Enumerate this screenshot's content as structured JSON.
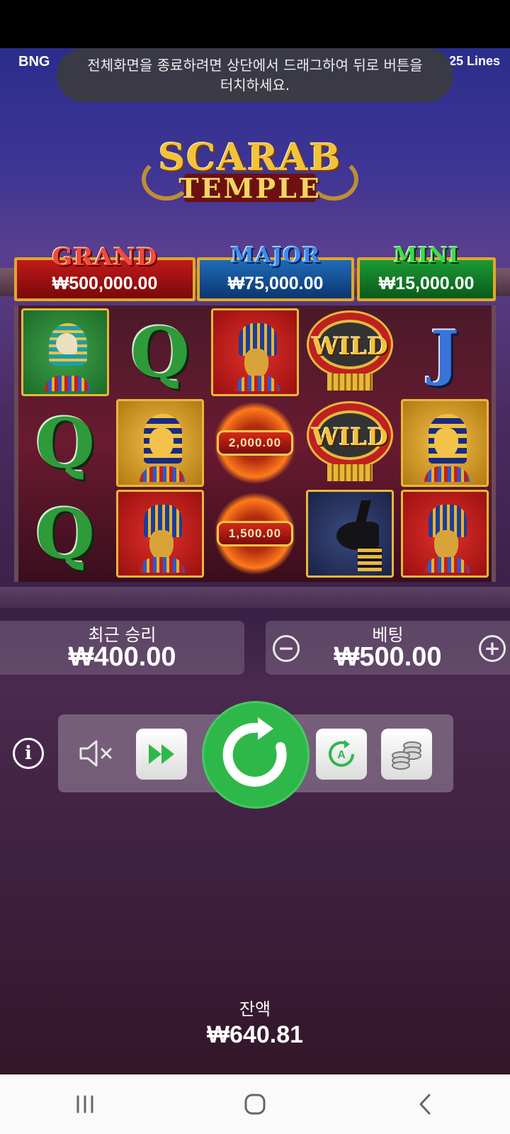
{
  "header": {
    "brand": "BNG",
    "lines": "25 Lines"
  },
  "toast": {
    "message": "전체화면을 종료하려면 상단에서 드래그하여 뒤로 버튼을 터치하세요."
  },
  "logo": {
    "line1": "SCARAB",
    "line2": "TEMPLE"
  },
  "jackpots": {
    "grand": {
      "label": "GRAND",
      "amount": "₩500,000.00"
    },
    "major": {
      "label": "MAJOR",
      "amount": "₩75,000.00"
    },
    "mini": {
      "label": "MINI",
      "amount": "₩15,000.00"
    }
  },
  "reels": {
    "symbols": [
      [
        "horus",
        "queen-q",
        "nefertiti",
        "wild",
        "jack-j"
      ],
      [
        "queen-q",
        "pharaoh",
        "scarab",
        "wild",
        "pharaoh"
      ],
      [
        "queen-q",
        "nefertiti",
        "scarab",
        "anubis",
        "nefertiti"
      ]
    ],
    "letters": {
      "q": "Q",
      "j": "J",
      "wild": "WILD"
    },
    "scarab_values": [
      "2,000.00",
      "1,500.00"
    ]
  },
  "win": {
    "label": "최근 승리",
    "value": "₩400.00"
  },
  "bet": {
    "label": "베팅",
    "value": "₩500.00",
    "minus": "−",
    "plus": "+"
  },
  "info_icon": "i",
  "balance": {
    "label": "잔액",
    "value": "₩640.81"
  },
  "colors": {
    "spin_button": "#2fb84a",
    "grand": "#c01a1a",
    "major": "#1f6bb8",
    "mini": "#1b9a35"
  }
}
